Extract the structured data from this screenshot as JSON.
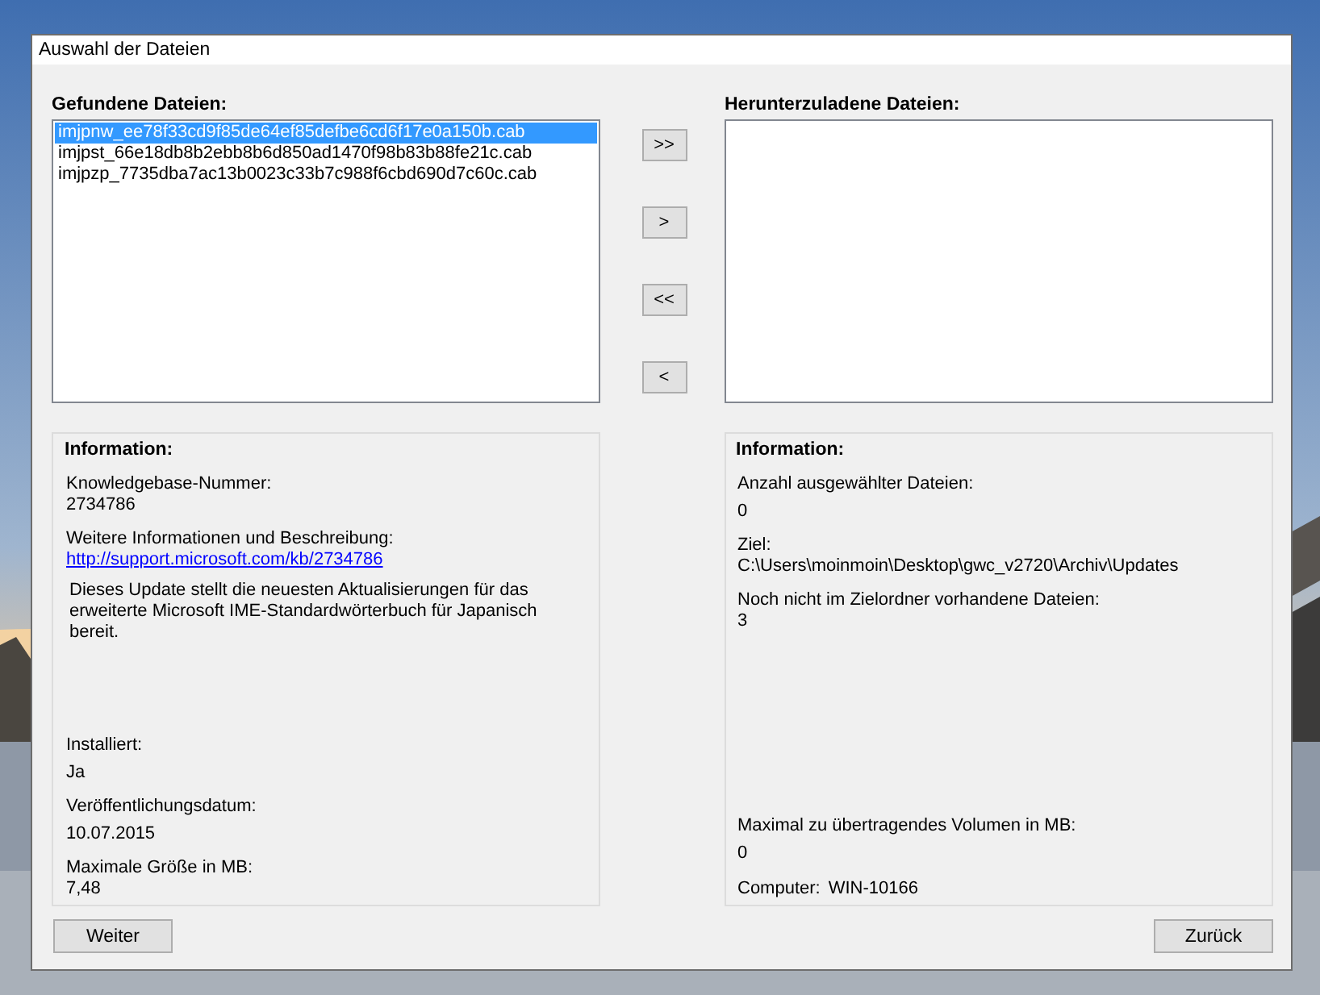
{
  "window": {
    "title": "Auswahl der Dateien"
  },
  "found_files": {
    "label": "Gefundene Dateien:",
    "items": [
      {
        "text": "imjpnw_ee78f33cd9f85de64ef85defbe6cd6f17e0a150b.cab",
        "selected": true
      },
      {
        "text": "imjpst_66e18db8b2ebb8b6d850ad1470f98b83b88fe21c.cab",
        "selected": false
      },
      {
        "text": "imjpzp_7735dba7ac13b0023c33b7c988f6cbd690d7c60c.cab",
        "selected": false
      }
    ]
  },
  "transfer_buttons": [
    ">>",
    ">",
    "<<",
    "<"
  ],
  "download_files": {
    "label": "Herunterzuladene Dateien:"
  },
  "info_left": {
    "title": "Information:",
    "top": [
      {
        "kind": "field",
        "label": "Knowledgebase-Nummer:",
        "value": "2734786"
      },
      {
        "kind": "link",
        "label": "Weitere Informationen und Beschreibung:",
        "value": "http://support.microsoft.com/kb/2734786"
      },
      {
        "kind": "note",
        "text": "Dieses Update stellt die neuesten Aktualisierungen für das erweiterte Microsoft IME-Standardwörterbuch für Japanisch bereit."
      }
    ],
    "bottom": [
      {
        "kind": "field-spaced",
        "label": "Installiert:",
        "value": "Ja"
      },
      {
        "kind": "field-spaced",
        "label": "Veröffentlichungsdatum:",
        "value": "10.07.2015"
      },
      {
        "kind": "field",
        "label": "Maximale Größe in MB:",
        "value": "7,48"
      }
    ]
  },
  "info_right": {
    "title": "Information:",
    "top": [
      {
        "kind": "field-spaced",
        "label": "Anzahl ausgewählter Dateien:",
        "value": "0"
      },
      {
        "kind": "field",
        "label": "Ziel:",
        "value": "C:\\Users\\moinmoin\\Desktop\\gwc_v2720\\Archiv\\Updates"
      },
      {
        "kind": "field",
        "label": "Noch nicht im Zielordner vorhandene Dateien:",
        "value": "3"
      }
    ],
    "bottom": [
      {
        "kind": "field-spaced",
        "label": "Maximal zu übertragendes Volumen in MB:",
        "value": "0"
      },
      {
        "kind": "inline",
        "label": "Computer:",
        "value": "WIN-10166"
      }
    ]
  },
  "buttons": [
    "Weiter",
    "Zurück"
  ]
}
